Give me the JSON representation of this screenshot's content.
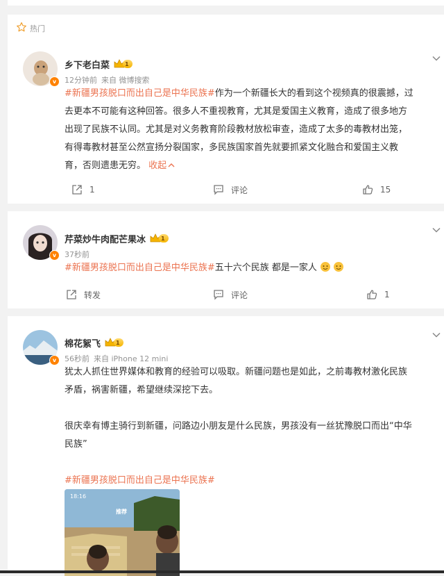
{
  "hot_section": {
    "label": "热门"
  },
  "comments": [
    {
      "username": "乡下老白菜",
      "level": "1",
      "time": "12分钟前",
      "source": "来自 微博搜索",
      "topic": "#新疆男孩脱口而出自己是中华民族#",
      "lines": [
        "作为一个新疆长大的看到这个视频真的很震撼，过",
        "去更本不可能有这种回答。很多人不重视教育，尤其是爱国主义教育，造成了很多地方",
        "出现了民族不认同。尤其是对义务教育阶段教材放松审查，造成了太多的毒教材出笼，",
        "有得毒教材甚至公然宣扬分裂国家，多民族国家首先就要抓紧文化融合和爱国主义教",
        "育，否则遗患无穷。"
      ],
      "collapse_label": "收起",
      "share_label": "1",
      "comment_label": "评论",
      "like_count": "15"
    },
    {
      "username": "芹菜炒牛肉配芒果冰",
      "level": "1",
      "time": "37秒前",
      "topic": "#新疆男孩脱口而出自己是中华民族#",
      "text": "五十六个民族 都是一家人",
      "share_label": "转发",
      "comment_label": "评论",
      "like_count": "1"
    },
    {
      "username": "棉花絮飞",
      "level": "1",
      "time": "56秒前",
      "source": "来自 iPhone 12 mini",
      "para1": [
        "犹太人抓住世界媒体和教育的经验可以吸取。新疆问题也是如此，之前毒教材激化民族",
        "矛盾，祸害新疆，希望继续深挖下去。"
      ],
      "para2": [
        "很庆幸有博主骑行到新疆，问路边小朋友是什么民族，男孩没有一丝犹豫脱口而出“中华",
        "民族”"
      ],
      "topic": "#新疆男孩脱口而出自己是中华民族#",
      "video": {
        "status_time": "18:16",
        "tab": "推荐"
      }
    }
  ],
  "colors": {
    "accent": "#eb7350",
    "vip": "#ff8200",
    "meta": "#939393"
  },
  "icons": [
    "star-icon",
    "chevron-down-icon",
    "share-icon",
    "comment-icon",
    "like-icon",
    "verified-badge-icon",
    "crown-icon",
    "smiley-emoji-icon"
  ]
}
